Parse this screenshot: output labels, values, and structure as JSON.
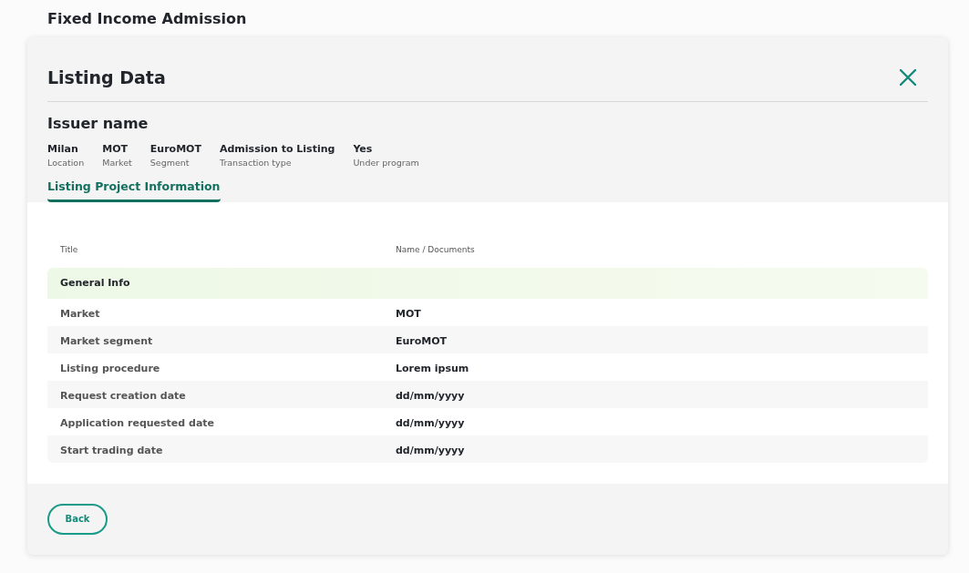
{
  "page_title": "Fixed Income Admission",
  "dialog": {
    "title": "Listing Data",
    "issuer": "Issuer name",
    "summary": [
      {
        "value": "Milan",
        "label": "Location"
      },
      {
        "value": "MOT",
        "label": "Market"
      },
      {
        "value": "EuroMOT",
        "label": "Segment"
      },
      {
        "value": "Admission to Listing",
        "label": "Transaction type"
      },
      {
        "value": "Yes",
        "label": "Under program"
      }
    ],
    "tabs": [
      {
        "label": "Listing Project Information",
        "selected": true
      }
    ],
    "table": {
      "columns": [
        "Title",
        "Name / Documents"
      ],
      "sections": [
        {
          "title": "General Info",
          "rows": [
            {
              "title": "Market",
              "value": "MOT"
            },
            {
              "title": "Market segment",
              "value": "EuroMOT"
            },
            {
              "title": "Listing procedure",
              "value": "Lorem ipsum"
            },
            {
              "title": "Request creation date",
              "value": "dd/mm/yyyy"
            },
            {
              "title": "Application requested date",
              "value": "dd/mm/yyyy"
            },
            {
              "title": "Start trading date",
              "value": "dd/mm/yyyy"
            }
          ]
        }
      ]
    },
    "buttons": [
      "Back"
    ]
  }
}
